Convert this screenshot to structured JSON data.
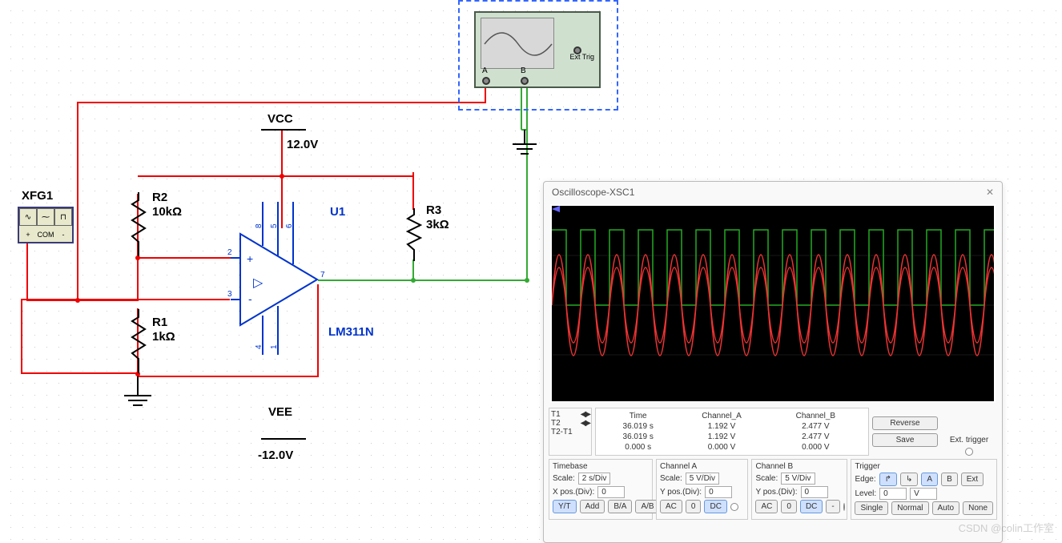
{
  "instruments": {
    "xfg_name": "XFG1",
    "xfg_ports": [
      "+",
      "COM",
      "-"
    ],
    "scope_cutoff_label": "",
    "ext_trig_label": "Ext Trig",
    "scope_ports": [
      "A",
      "B"
    ]
  },
  "supply": {
    "vcc_name": "VCC",
    "vcc_value": "12.0V",
    "vee_name": "VEE",
    "vee_value": "-12.0V"
  },
  "components": {
    "r1_name": "R1",
    "r1_value": "1kΩ",
    "r2_name": "R2",
    "r2_value": "10kΩ",
    "r3_name": "R3",
    "r3_value": "3kΩ",
    "u1_name": "U1",
    "u1_part": "LM311N",
    "pins": {
      "in_plus": "2",
      "in_minus": "3",
      "out": "7",
      "vplus": "8",
      "vminus": "4",
      "bal1": "5",
      "bal2": "6",
      "gnd": "1"
    }
  },
  "oscilloscope": {
    "title": "Oscilloscope-XSC1",
    "cursors": {
      "t1": "T1",
      "t2": "T2",
      "diff": "T2-T1"
    },
    "headers": {
      "time": "Time",
      "cha": "Channel_A",
      "chb": "Channel_B"
    },
    "readout": {
      "t1": {
        "time": "36.019 s",
        "a": "1.192 V",
        "b": "2.477 V"
      },
      "t2": {
        "time": "36.019 s",
        "a": "1.192 V",
        "b": "2.477 V"
      },
      "diff": {
        "time": "0.000 s",
        "a": "0.000 V",
        "b": "0.000 V"
      }
    },
    "buttons": {
      "reverse": "Reverse",
      "save": "Save",
      "ext_trigger": "Ext. trigger"
    },
    "timebase": {
      "label": "Timebase",
      "scale_label": "Scale:",
      "scale": "2  s/Div",
      "xpos_label": "X pos.(Div):",
      "xpos": "0",
      "modes": [
        "Y/T",
        "Add",
        "B/A",
        "A/B"
      ]
    },
    "cha_panel": {
      "label": "Channel A",
      "scale_label": "Scale:",
      "scale": "5  V/Div",
      "ypos_label": "Y pos.(Div):",
      "ypos": "0",
      "modes": [
        "AC",
        "0",
        "DC"
      ]
    },
    "chb_panel": {
      "label": "Channel B",
      "scale_label": "Scale:",
      "scale": "5  V/Div",
      "ypos_label": "Y pos.(Div):",
      "ypos": "0",
      "modes": [
        "AC",
        "0",
        "DC",
        "-"
      ]
    },
    "trigger": {
      "label": "Trigger",
      "edge_label": "Edge:",
      "edges": [
        "↱",
        "↳"
      ],
      "sources": [
        "A",
        "B",
        "Ext"
      ],
      "level_label": "Level:",
      "level": "0",
      "level_unit": "V",
      "modes": [
        "Single",
        "Normal",
        "Auto",
        "None"
      ]
    }
  },
  "watermark": "CSDN @colin工作室"
}
